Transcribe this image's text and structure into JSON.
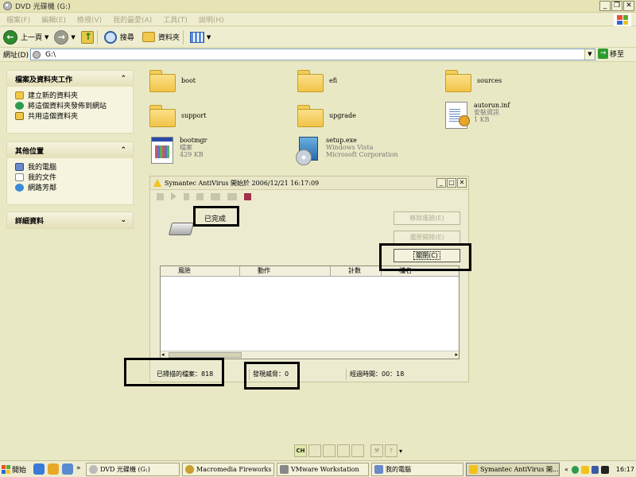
{
  "window": {
    "title": "DVD 光碟機 (G:)",
    "controls": [
      "_",
      "❐",
      "✕"
    ]
  },
  "menu": [
    "檔案(F)",
    "編輯(E)",
    "檢視(V)",
    "我的最愛(A)",
    "工具(T)",
    "說明(H)"
  ],
  "toolbar": {
    "back_label": "上一頁",
    "search_label": "搜尋",
    "folders_label": "資料夾"
  },
  "address": {
    "label": "網址(D)",
    "value": "G:\\",
    "go_label": "移至"
  },
  "tasks_pane": {
    "title": "檔案及資料夾工作",
    "items": [
      "建立新的資料夾",
      "將這個資料夾發佈到網站",
      "共用這個資料夾"
    ]
  },
  "other_pane": {
    "title": "其他位置",
    "items": [
      "我的電腦",
      "我的文件",
      "網路芳鄰"
    ]
  },
  "details_pane": {
    "title": "詳細資料"
  },
  "files": [
    {
      "name": "boot"
    },
    {
      "name": "efi"
    },
    {
      "name": "sources"
    },
    {
      "name": "support"
    },
    {
      "name": "upgrade"
    },
    {
      "name": "autorun.inf",
      "meta1": "安裝資訊",
      "meta2": "1 KB"
    },
    {
      "name": "bootmgr",
      "meta1": "檔案",
      "meta2": "429 KB"
    },
    {
      "name": "setup.exe",
      "meta1": "Windows Vista",
      "meta2": "Microsoft Corporation"
    }
  ],
  "dialog": {
    "title": "Symantec AntiVirus 開始於 2006/12/21 16:17:09",
    "status": "已完成",
    "btn_move": "移除風險(E)",
    "btn_restore": "還原開除(E)",
    "btn_close": "關閉(C)",
    "columns": [
      "風險",
      "動作",
      "計數",
      "檔名"
    ],
    "scanned": "已掃描的檔案：818",
    "threats": "發現威脅：0",
    "elapsed": "經過時間：00：18"
  },
  "taskbar": {
    "start": "開始",
    "tasks": [
      "DVD 光碟機 (G:)",
      "Macromedia Fireworks ...",
      "VMware Workstation",
      "我的電腦",
      "Symantec AntiVirus 開..."
    ],
    "clock": "16:17"
  },
  "colors": {
    "background": "#e9e8c4",
    "accent_green": "#2e8b2e",
    "highlight_border": "#000000"
  }
}
